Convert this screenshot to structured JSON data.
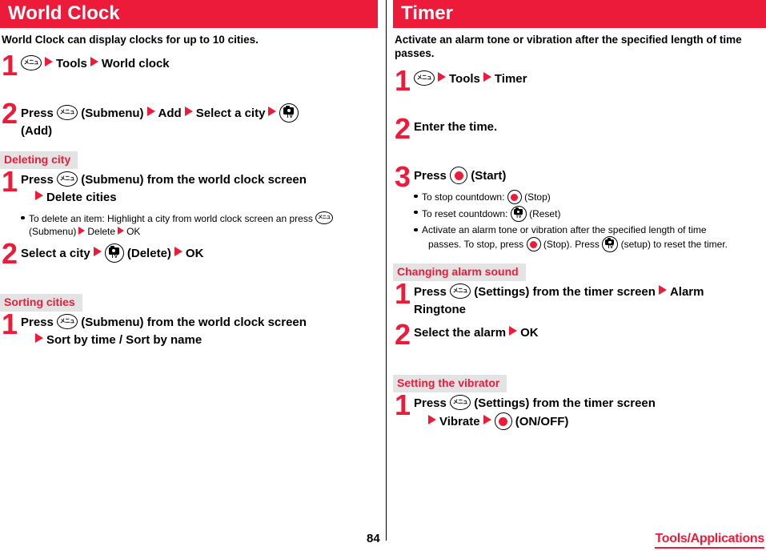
{
  "footer": {
    "page_number": "84",
    "chapter": "Tools/Applications"
  },
  "icons": {
    "menu_key": "menu-key-icon",
    "menu_key_label": "メニュー",
    "camera_key": "camera-tv-key-icon",
    "camera_key_label": "TV",
    "center_key": "center-select-key-icon"
  },
  "colors": {
    "accent_red": "#ED1B3A",
    "subhead_bg": "#E3E3E3",
    "text": "#000000"
  },
  "left_column": {
    "title": "World Clock",
    "intro": "World Clock can display clocks for up to 10 cities.",
    "steps": [
      {
        "num": "1",
        "parts": [
          "Tools",
          "World clock"
        ]
      },
      {
        "num": "2",
        "press_label": "Press",
        "submenu_label": "(Submenu)",
        "add_label": "Add",
        "select_city_label": "Select a city",
        "add_paren_label": "(Add)"
      }
    ],
    "sections": [
      {
        "heading": "Deleting city",
        "steps": [
          {
            "num": "1",
            "press_label": "Press",
            "submenu_label": "(Submenu) from the world clock screen",
            "cont_label": "Delete cities",
            "note": {
              "line1": "To delete an item: Highlight a city from world clock screen an press",
              "line2_submenu": "(Submenu)",
              "line2_delete": "Delete",
              "line2_ok": "OK"
            }
          },
          {
            "num": "2",
            "select_city_label": "Select a city",
            "delete_label": "(Delete)",
            "ok_label": "OK"
          }
        ]
      },
      {
        "heading": "Sorting cities",
        "steps": [
          {
            "num": "1",
            "press_label": "Press",
            "submenu_label": "(Submenu) from the world clock screen",
            "cont_label": "Sort by time / Sort by name"
          }
        ]
      }
    ]
  },
  "right_column": {
    "title": "Timer",
    "intro": "Activate an alarm tone or vibration after the specified length of time passes.",
    "steps": [
      {
        "num": "1",
        "parts": [
          "Tools",
          "Timer"
        ]
      },
      {
        "num": "2",
        "text": "Enter the time."
      },
      {
        "num": "3",
        "press_label": "Press",
        "start_label": "(Start)",
        "notes": [
          {
            "prefix": "To stop countdown:",
            "suffix": "(Stop)"
          },
          {
            "prefix": "To reset countdown:",
            "suffix": "(Reset)"
          }
        ],
        "note_long": {
          "line1": "Activate an alarm tone or vibration after the specified length of time",
          "line2a": "passes. To stop, press",
          "line2b": "(Stop). Press",
          "line2c": "(setup) to reset the timer."
        }
      }
    ],
    "sections": [
      {
        "heading": "Changing alarm sound",
        "steps": [
          {
            "num": "1",
            "press_label": "Press",
            "settings_label": "(Settings) from the timer screen",
            "alarm_label": "Alarm",
            "cont_label": "Ringtone"
          },
          {
            "num": "2",
            "select_alarm_label": "Select the alarm",
            "ok_label": "OK"
          }
        ]
      },
      {
        "heading": "Setting the vibrator",
        "steps": [
          {
            "num": "1",
            "press_label": "Press",
            "settings_label": "(Settings) from the timer screen",
            "vibrate_label": "Vibrate",
            "onoff_label": "(ON/OFF)"
          }
        ]
      }
    ]
  }
}
